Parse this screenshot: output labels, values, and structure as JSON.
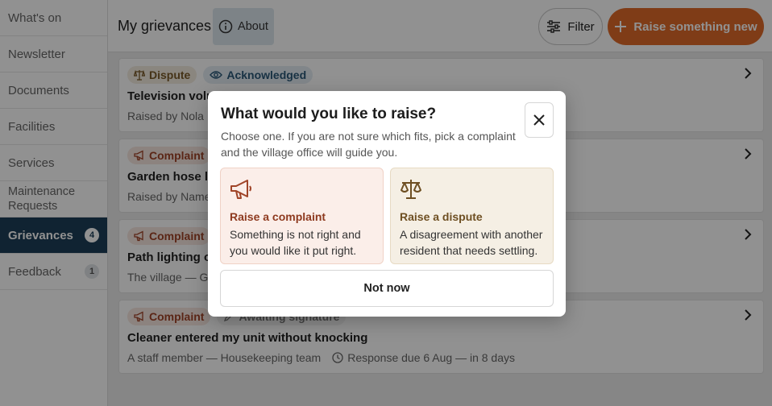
{
  "sidebar": {
    "items": [
      {
        "label": "What's on"
      },
      {
        "label": "Newsletter"
      },
      {
        "label": "Documents"
      },
      {
        "label": "Facilities"
      },
      {
        "label": "Services"
      },
      {
        "label": "Maintenance Requests"
      },
      {
        "label": "Grievances",
        "count": "4",
        "active": true
      },
      {
        "label": "Feedback",
        "count": "1"
      }
    ]
  },
  "header": {
    "title": "My grievances",
    "about_label": "About",
    "filter_label": "Filter",
    "raise_label": "Raise something new"
  },
  "grievances": [
    {
      "type": "Dispute",
      "status": "Acknowledged",
      "title": "Television volu",
      "meta": "Raised by Nola F"
    },
    {
      "type": "Complaint",
      "title": "Garden hose lef",
      "meta": "Raised by Name"
    },
    {
      "type": "Complaint",
      "title": "Path lighting ou",
      "meta": "The village — Gr"
    },
    {
      "type": "Complaint",
      "status": "Awaiting signature",
      "title": "Cleaner entered my unit without knocking",
      "meta": "A staff member — Housekeeping team",
      "due": "Response due 6 Aug — in 8 days"
    }
  ],
  "modal": {
    "title": "What would you like to raise?",
    "description": "Choose one. If you are not sure which fits, pick a complaint and the village office will guide you.",
    "complaint_title": "Raise a complaint",
    "complaint_desc": "Something is not right and you would like it put right.",
    "dispute_title": "Raise a dispute",
    "dispute_desc": "A disagreement with another resident that needs settling.",
    "dismiss_label": "Not now"
  },
  "colors": {
    "accent": "#e06a2a",
    "sidebar_active": "#1d3f58",
    "complaint": "#a04428",
    "dispute": "#7a5a2a"
  }
}
